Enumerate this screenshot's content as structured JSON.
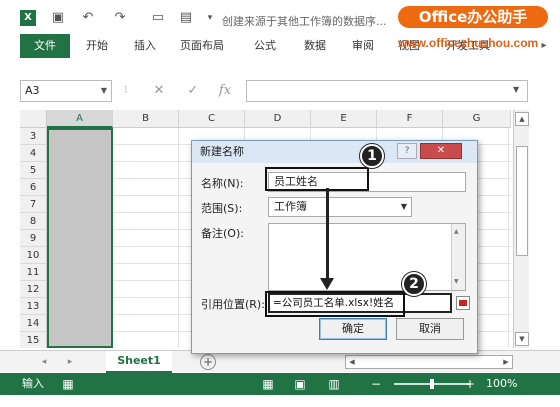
{
  "app": {
    "logo_letter": "X",
    "document_title": "创建来源于其他工作簿的数据序...",
    "brand_badge": "Office办公助手",
    "brand_url": "www.officezhushou.com"
  },
  "ribbon": {
    "tabs": [
      "文件",
      "开始",
      "插入",
      "页面布局",
      "公式",
      "数据",
      "审阅",
      "视图",
      "开发工具"
    ]
  },
  "formula_bar": {
    "name_box": "A3",
    "fx_label": "fx",
    "formula": ""
  },
  "grid": {
    "columns": [
      "A",
      "B",
      "C",
      "D",
      "E",
      "F",
      "G"
    ],
    "rows": [
      "3",
      "4",
      "5",
      "6",
      "7",
      "8",
      "9",
      "10",
      "11",
      "12",
      "13",
      "14",
      "15",
      "16"
    ],
    "selected_column": "A"
  },
  "sheets": {
    "active_tab": "Sheet1"
  },
  "statusbar": {
    "mode": "输入",
    "zoom": "100%"
  },
  "dialog": {
    "title": "新建名称",
    "help_label": "?",
    "close_label": "✕",
    "name_label": "名称(N):",
    "name_value": "员工姓名",
    "scope_label": "范围(S):",
    "scope_value": "工作簿",
    "comment_label": "备注(O):",
    "refers_to_label": "引用位置(R):",
    "refers_to_value": "=公司员工名单.xlsx!姓名",
    "ok_label": "确定",
    "cancel_label": "取消"
  },
  "annotations": {
    "marker1": "1",
    "marker2": "2"
  }
}
